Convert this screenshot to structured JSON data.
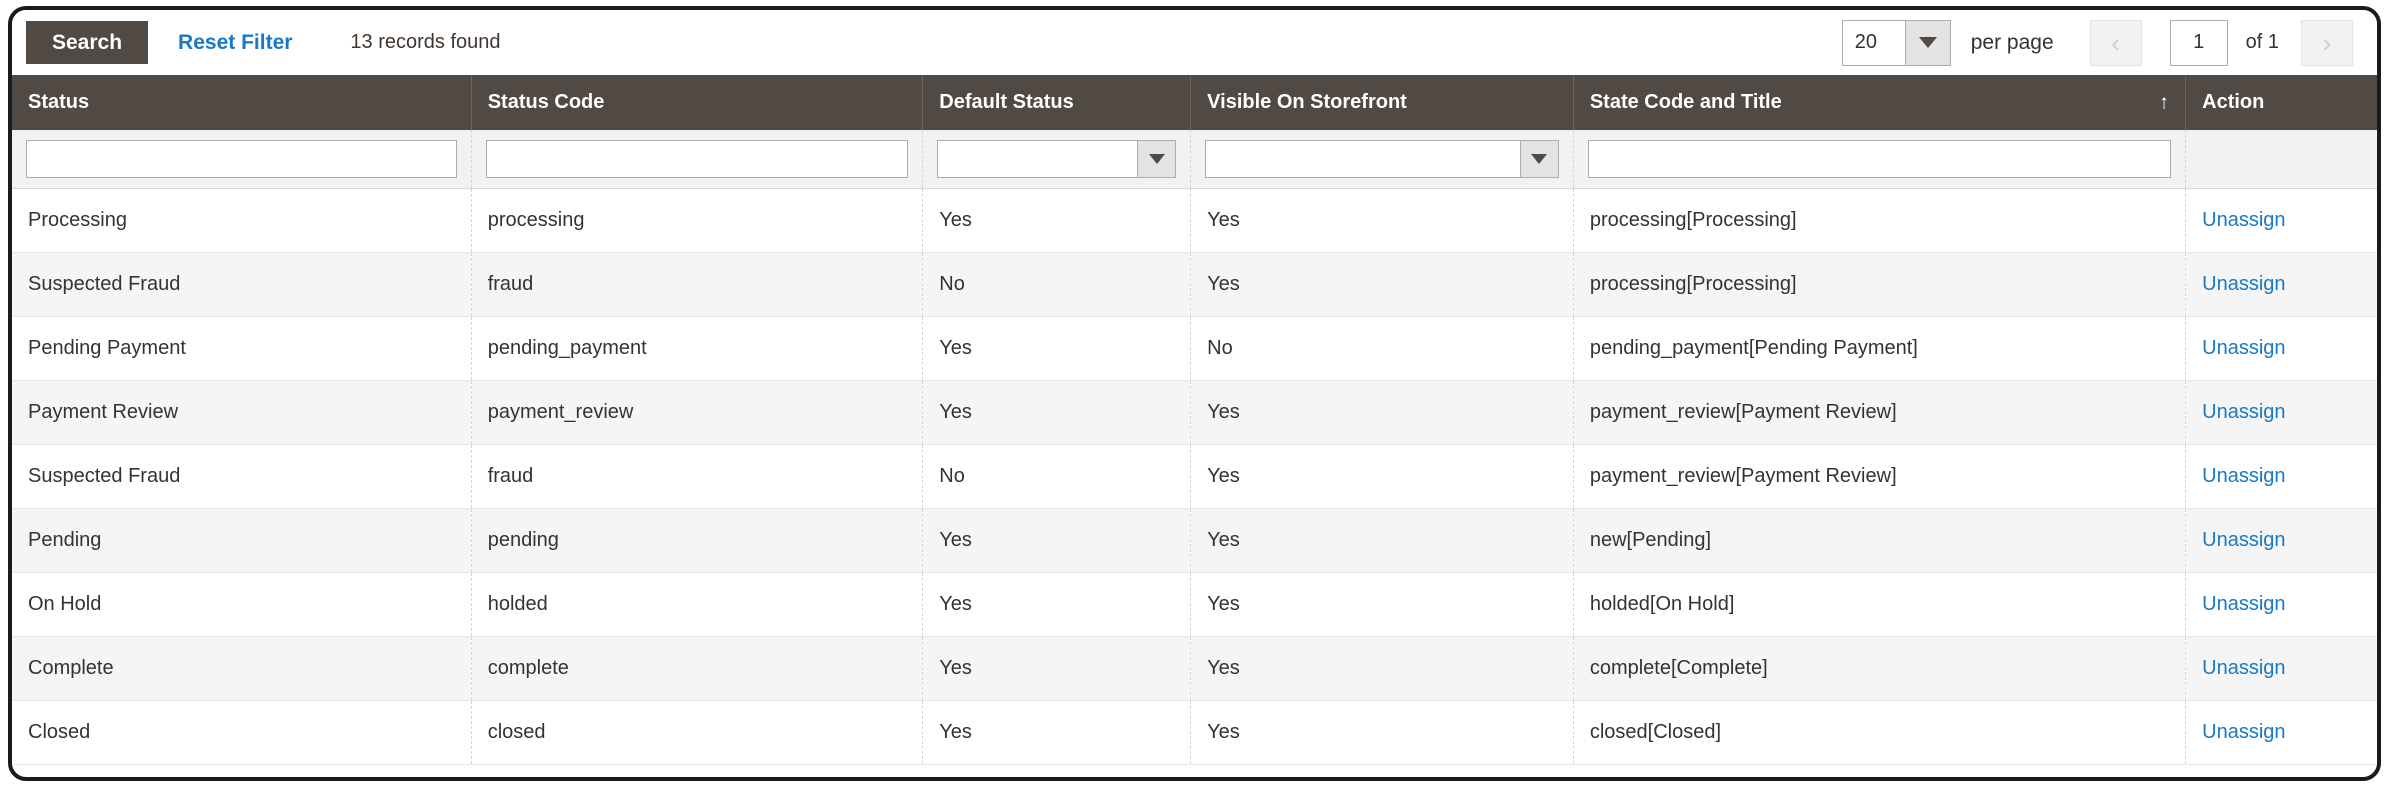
{
  "toolbar": {
    "search_label": "Search",
    "reset_filter_label": "Reset Filter",
    "records_found": "13 records found"
  },
  "pager": {
    "per_page_value": "20",
    "per_page_label": "per page",
    "prev_icon": "chevron-left-icon",
    "next_icon": "chevron-right-icon",
    "prev_glyph": "‹",
    "next_glyph": "›",
    "current_page": "1",
    "of_label": "of 1"
  },
  "grid": {
    "columns": [
      {
        "label": "Status",
        "filter_type": "text",
        "filter_value": ""
      },
      {
        "label": "Status Code",
        "filter_type": "text",
        "filter_value": ""
      },
      {
        "label": "Default Status",
        "filter_type": "select",
        "filter_value": ""
      },
      {
        "label": "Visible On Storefront",
        "filter_type": "select",
        "filter_value": ""
      },
      {
        "label": "State Code and Title",
        "filter_type": "text",
        "filter_value": "",
        "sorted": true,
        "sort_glyph": "↑"
      },
      {
        "label": "Action",
        "filter_type": "none"
      }
    ],
    "action_label": "Unassign",
    "rows": [
      {
        "status": "Processing",
        "status_code": "processing",
        "default_status": "Yes",
        "visible_on_storefront": "Yes",
        "state_code_and_title": "processing[Processing]",
        "action": "Unassign"
      },
      {
        "status": "Suspected Fraud",
        "status_code": "fraud",
        "default_status": "No",
        "visible_on_storefront": "Yes",
        "state_code_and_title": "processing[Processing]",
        "action": "Unassign"
      },
      {
        "status": "Pending Payment",
        "status_code": "pending_payment",
        "default_status": "Yes",
        "visible_on_storefront": "No",
        "state_code_and_title": "pending_payment[Pending Payment]",
        "action": "Unassign"
      },
      {
        "status": "Payment Review",
        "status_code": "payment_review",
        "default_status": "Yes",
        "visible_on_storefront": "Yes",
        "state_code_and_title": "payment_review[Payment Review]",
        "action": "Unassign"
      },
      {
        "status": "Suspected Fraud",
        "status_code": "fraud",
        "default_status": "No",
        "visible_on_storefront": "Yes",
        "state_code_and_title": "payment_review[Payment Review]",
        "action": "Unassign"
      },
      {
        "status": "Pending",
        "status_code": "pending",
        "default_status": "Yes",
        "visible_on_storefront": "Yes",
        "state_code_and_title": "new[Pending]",
        "action": "Unassign"
      },
      {
        "status": "On Hold",
        "status_code": "holded",
        "default_status": "Yes",
        "visible_on_storefront": "Yes",
        "state_code_and_title": "holded[On Hold]",
        "action": "Unassign"
      },
      {
        "status": "Complete",
        "status_code": "complete",
        "default_status": "Yes",
        "visible_on_storefront": "Yes",
        "state_code_and_title": "complete[Complete]",
        "action": "Unassign"
      },
      {
        "status": "Closed",
        "status_code": "closed",
        "default_status": "Yes",
        "visible_on_storefront": "Yes",
        "state_code_and_title": "closed[Closed]",
        "action": "Unassign"
      }
    ]
  },
  "colors": {
    "header_bg": "#514943",
    "link": "#1979c3",
    "filter_bg": "#f2f2f2",
    "row_alt_bg": "#f5f5f5"
  }
}
